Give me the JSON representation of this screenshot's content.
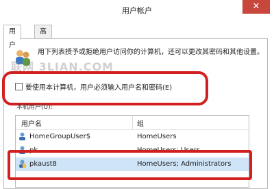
{
  "window": {
    "title": "用户帐户",
    "close_glyph": "✕"
  },
  "tabs": [
    {
      "label": "用户",
      "active": true
    },
    {
      "label": "高级",
      "active": false
    }
  ],
  "info": {
    "text": "用下列表授予或拒绝用户访问你的计算机，还可以更改其密码和其他设置。",
    "watermark": "联网 3LIAN.COM"
  },
  "require_password": {
    "label": "要使用本计算机，用户必须输入用户名和密码(E)",
    "checked": false
  },
  "users_section": {
    "label": "本机用户(U):"
  },
  "table": {
    "headers": {
      "name": "用户名",
      "group": "组"
    },
    "rows": [
      {
        "name": "HomeGroupUser$",
        "group": "HomeUsers",
        "selected": false
      },
      {
        "name": "pk",
        "group": "HomeUsers; Users",
        "selected": false
      },
      {
        "name": "pkaust8",
        "group": "HomeUsers; Administrators",
        "selected": true
      }
    ]
  },
  "colors": {
    "highlight": "#d21f1f",
    "selection": "#cfe4f7",
    "close": "#c8473d"
  }
}
